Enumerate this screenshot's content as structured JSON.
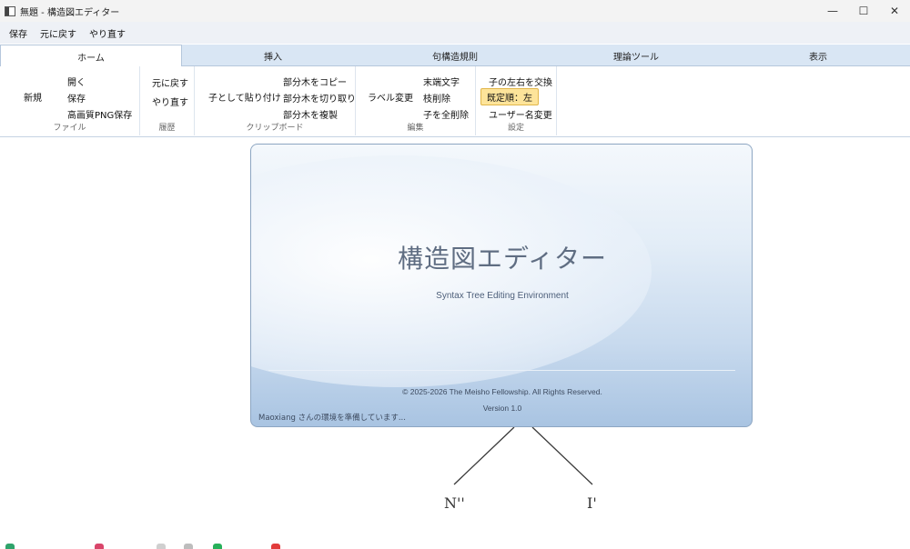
{
  "window": {
    "title": "無題 - 構造図エディター",
    "controls": [
      "—",
      "☐",
      "✕"
    ]
  },
  "quick_access": {
    "save": "保存",
    "undo": "元に戻す",
    "redo": "やり直す"
  },
  "tabs": [
    "ホーム",
    "挿入",
    "句構造規則",
    "理論ツール",
    "表示"
  ],
  "ribbon": {
    "file": {
      "label": "ファイル",
      "new": "新規",
      "open": "開く",
      "save": "保存",
      "save_png": "高画質PNG保存"
    },
    "history": {
      "label": "履歴",
      "undo": "元に戻す",
      "redo": "やり直す"
    },
    "clipboard": {
      "label": "クリップボード",
      "paste_as_child": "子として貼り付け",
      "copy_subtree": "部分木をコピー",
      "cut_subtree": "部分木を切り取り",
      "duplicate_subtree": "部分木を複製"
    },
    "edit": {
      "label": "編集",
      "change_label": "ラベル変更",
      "terminal_text": "末端文字",
      "delete_branch": "枝削除",
      "delete_all_children": "子を全削除"
    },
    "settings": {
      "label": "設定",
      "swap_children": "子の左右を交換",
      "default_order": "既定順：左",
      "change_username": "ユーザー名変更"
    }
  },
  "splash": {
    "title": "構造図エディター",
    "subtitle": "Syntax Tree Editing Environment",
    "copyright": "© 2025-2026 The Meisho Fellowship. All Rights Reserved.",
    "version": "Version 1.0",
    "status": "Maoxiang さんの環境を準備しています..."
  },
  "tree": {
    "left_node": "N''",
    "right_node": "I'"
  },
  "colors": {
    "tab_strip": "#d9e6f4",
    "highlight": "#fde49a",
    "splash_bottom": "#a9c4e2"
  }
}
